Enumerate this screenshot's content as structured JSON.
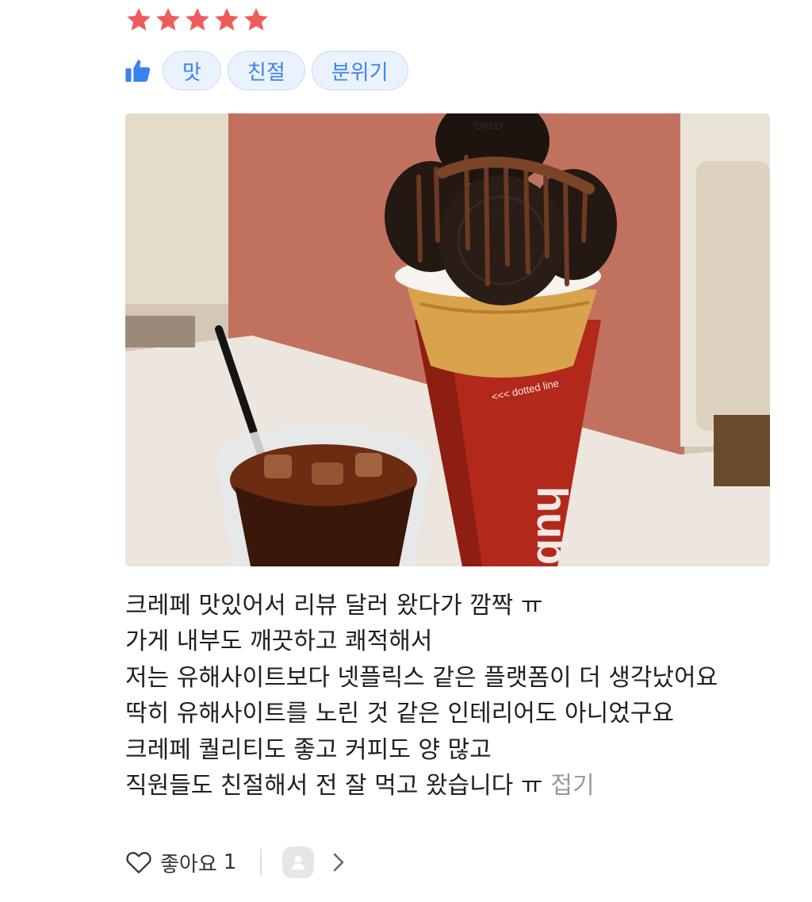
{
  "rating": {
    "stars": 5,
    "max": 5,
    "color": "#ef5b5b"
  },
  "tags": [
    "맛",
    "친절",
    "분위기"
  ],
  "accent_color": "#3b82f0",
  "photo": {
    "icon": "review-photo",
    "cup_text": "<<< dotted line",
    "cup_brand": "hub",
    "cookie_text": "OREO"
  },
  "review": {
    "lines": [
      "크레페 맛있어서 리뷰 달러 왔다가 깜짝 ㅠ",
      "가게 내부도 깨끗하고 쾌적해서",
      "저는 유해사이트보다 넷플릭스 같은 플랫폼이 더 생각났어요",
      "딱히 유해사이트를 노린 것 같은 인테리어도 아니었구요",
      "크레페 퀄리티도 좋고 커피도 양 많고",
      "직원들도 친절해서 전 잘 먹고 왔습니다 ㅠ"
    ],
    "fold_label": "접기"
  },
  "footer": {
    "like_label": "좋아요",
    "like_count": "1",
    "heart_icon": "heart-outline-icon",
    "avatar_icon": "user-avatar-icon",
    "chevron_icon": "chevron-right-icon"
  }
}
